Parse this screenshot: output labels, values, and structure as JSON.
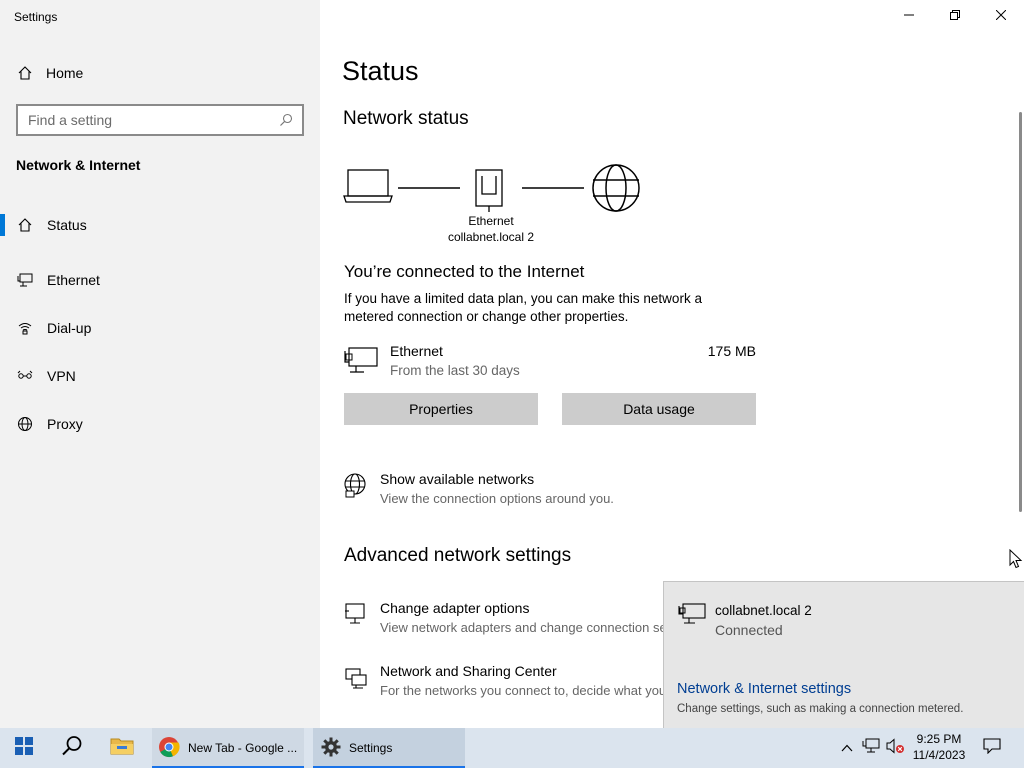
{
  "window": {
    "app_title": "Settings"
  },
  "sidebar": {
    "home_label": "Home",
    "search_placeholder": "Find a setting",
    "section_title": "Network & Internet",
    "items": [
      {
        "label": "Status",
        "icon": "home-status-icon",
        "active": true
      },
      {
        "label": "Ethernet",
        "icon": "ethernet-icon",
        "active": false
      },
      {
        "label": "Dial-up",
        "icon": "dialup-icon",
        "active": false
      },
      {
        "label": "VPN",
        "icon": "vpn-icon",
        "active": false
      },
      {
        "label": "Proxy",
        "icon": "globe-icon",
        "active": false
      }
    ]
  },
  "main": {
    "page_title": "Status",
    "network_status_title": "Network status",
    "diagram": {
      "adapter_label": "Ethernet",
      "network_label": "collabnet.local 2"
    },
    "connected_title": "You’re connected to the Internet",
    "connected_desc": "If you have a limited data plan, you can make this network a metered connection or change other properties.",
    "ethernet": {
      "name": "Ethernet",
      "period": "From the last 30 days",
      "usage": "175 MB"
    },
    "buttons": {
      "properties": "Properties",
      "data_usage": "Data usage"
    },
    "show_networks": {
      "title": "Show available networks",
      "desc": "View the connection options around you."
    },
    "advanced_title": "Advanced network settings",
    "adapter_options": {
      "title": "Change adapter options",
      "desc": "View network adapters and change connection settings."
    },
    "sharing_center": {
      "title": "Network and Sharing Center",
      "desc": "For the networks you connect to, decide what you want to share."
    }
  },
  "flyout": {
    "network_name": "collabnet.local 2",
    "status": "Connected",
    "settings_link": "Network & Internet settings",
    "settings_desc": "Change settings, such as making a connection metered."
  },
  "taskbar": {
    "chrome_label": "New Tab - Google ...",
    "settings_label": "Settings",
    "time": "9:25 PM",
    "date": "11/4/2023"
  },
  "colors": {
    "accent": "#0078d7",
    "link": "#003e92",
    "taskbar": "#dbe4ee"
  }
}
